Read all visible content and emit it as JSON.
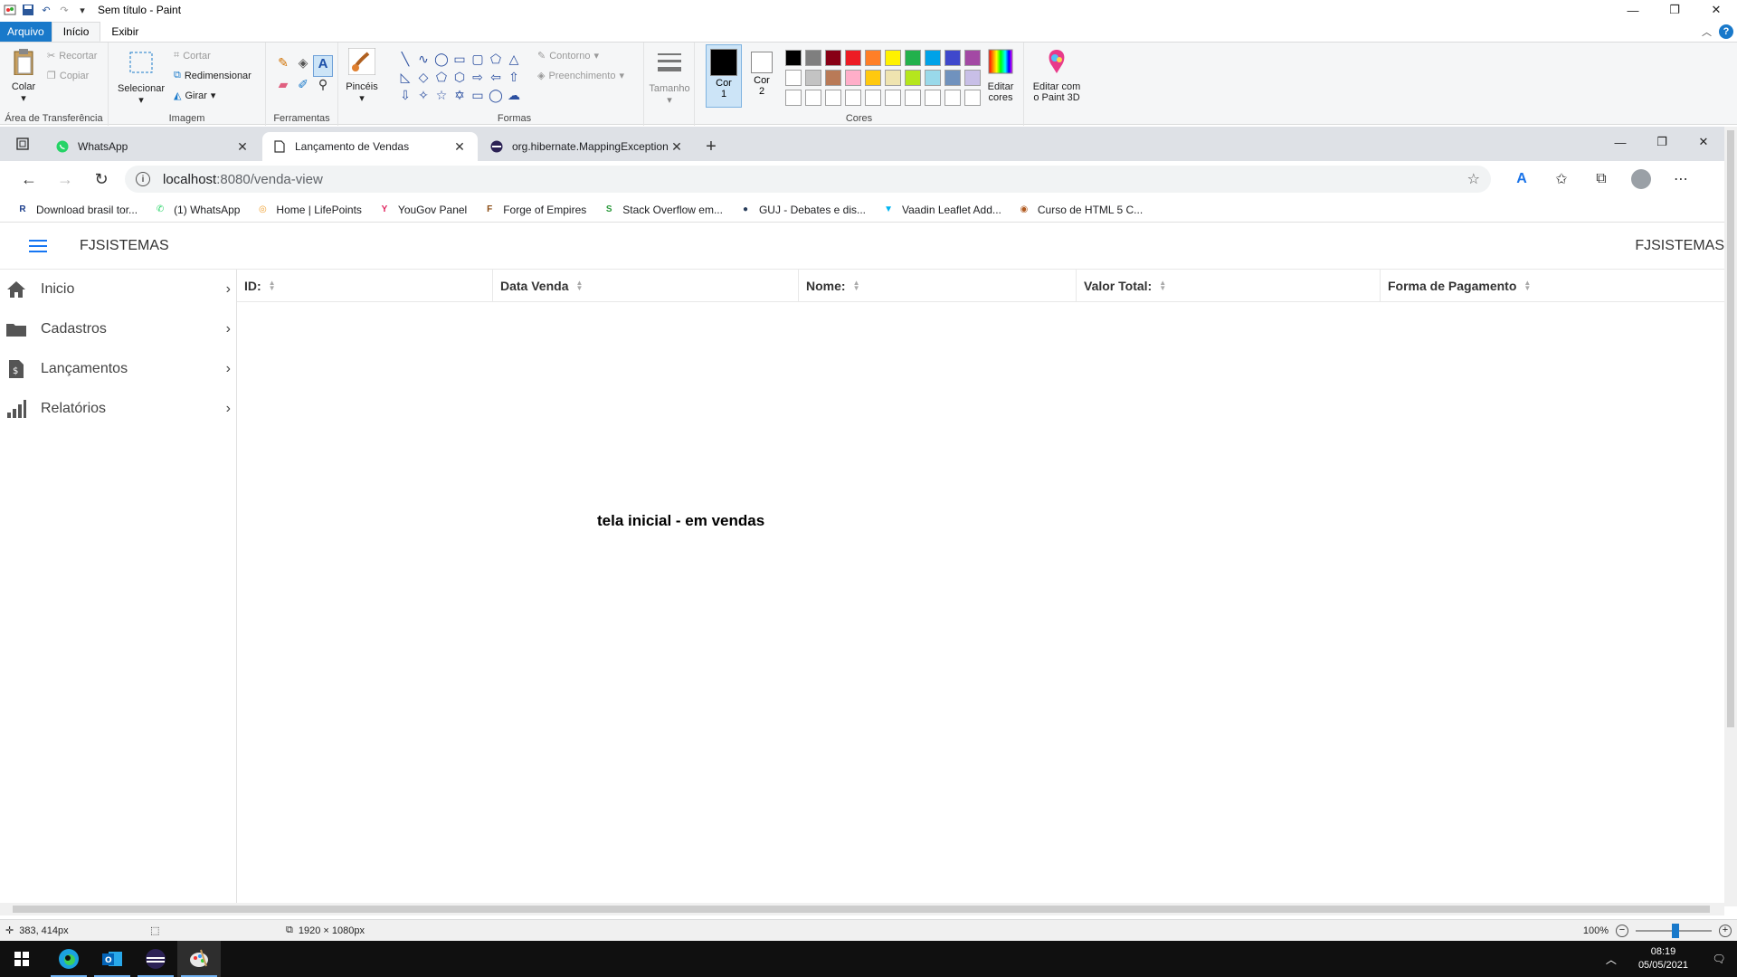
{
  "paint": {
    "title": "Sem título - Paint",
    "menu": {
      "file": "Arquivo",
      "home": "Início",
      "view": "Exibir"
    },
    "ribbon": {
      "clipboard": {
        "paste": "Colar",
        "cut": "Recortar",
        "copy": "Copiar",
        "label": "Área de Transferência"
      },
      "image": {
        "select": "Selecionar",
        "crop": "Cortar",
        "resize": "Redimensionar",
        "rotate": "Girar",
        "label": "Imagem"
      },
      "tools": {
        "label": "Ferramentas"
      },
      "brushes": "Pincéis",
      "shapes": {
        "outline": "Contorno",
        "fill": "Preenchimento",
        "label": "Formas"
      },
      "size": "Tamanho",
      "colors": {
        "color1_a": "Cor",
        "color1_b": "1",
        "color2_a": "Cor",
        "color2_b": "2",
        "edit_a": "Editar",
        "edit_b": "cores",
        "label": "Cores",
        "palette": [
          "#000000",
          "#7f7f7f",
          "#880015",
          "#ed1c24",
          "#ff7f27",
          "#fff200",
          "#22b14c",
          "#00a2e8",
          "#3f48cc",
          "#a349a4",
          "#ffffff",
          "#c3c3c3",
          "#b97a57",
          "#ffaec9",
          "#ffc90e",
          "#efe4b0",
          "#b5e61d",
          "#99d9ea",
          "#7092be",
          "#c8bfe7",
          "#ffffff",
          "#ffffff",
          "#ffffff",
          "#ffffff",
          "#ffffff",
          "#ffffff",
          "#ffffff",
          "#ffffff",
          "#ffffff",
          "#ffffff"
        ]
      },
      "paint3d_a": "Editar com",
      "paint3d_b": "o Paint 3D"
    },
    "status": {
      "cursor": "383, 414px",
      "canvas_size": "1920 × 1080px",
      "zoom": "100%"
    }
  },
  "browser": {
    "tabs": [
      {
        "label": "WhatsApp",
        "icon": "whatsapp-icon"
      },
      {
        "label": "Lançamento de Vendas",
        "icon": "page-icon"
      },
      {
        "label": "org.hibernate.MappingException",
        "icon": "eclipse-icon"
      }
    ],
    "url_host": "localhost",
    "url_path": ":8080/venda-view",
    "bookmarks": [
      {
        "label": "Download brasil tor...",
        "icon_char": "R",
        "color": "#1d3f8c"
      },
      {
        "label": "(1) WhatsApp",
        "icon_char": "✆",
        "color": "#25d366"
      },
      {
        "label": "Home | LifePoints",
        "icon_char": "◎",
        "color": "#f0a030"
      },
      {
        "label": "YouGov Panel",
        "icon_char": "Y",
        "color": "#e0245e"
      },
      {
        "label": "Forge of Empires",
        "icon_char": "F",
        "color": "#8a4b12"
      },
      {
        "label": "Stack Overflow em...",
        "icon_char": "S",
        "color": "#2c9a3c"
      },
      {
        "label": "GUJ - Debates e dis...",
        "icon_char": "●",
        "color": "#2a3e5c"
      },
      {
        "label": "Vaadin Leaflet Add...",
        "icon_char": "▼",
        "color": "#00b4f0"
      },
      {
        "label": "Curso de HTML 5 C...",
        "icon_char": "◉",
        "color": "#b05a20"
      }
    ]
  },
  "app": {
    "brand": "FJSISTEMAS",
    "brand_right": "FJSISTEMAS",
    "menu": [
      {
        "label": "Inicio",
        "icon": "home-icon"
      },
      {
        "label": "Cadastros",
        "icon": "folder-icon"
      },
      {
        "label": "Lançamentos",
        "icon": "invoice-icon"
      },
      {
        "label": "Relatórios",
        "icon": "bar-chart-icon"
      }
    ],
    "grid": {
      "columns": [
        "ID:",
        "Data Venda",
        "Nome:",
        "Valor Total:",
        "Forma de Pagamento"
      ],
      "empty_message": "tela inicial - em vendas"
    }
  },
  "taskbar": {
    "time": "08:19",
    "date": "05/05/2021"
  }
}
